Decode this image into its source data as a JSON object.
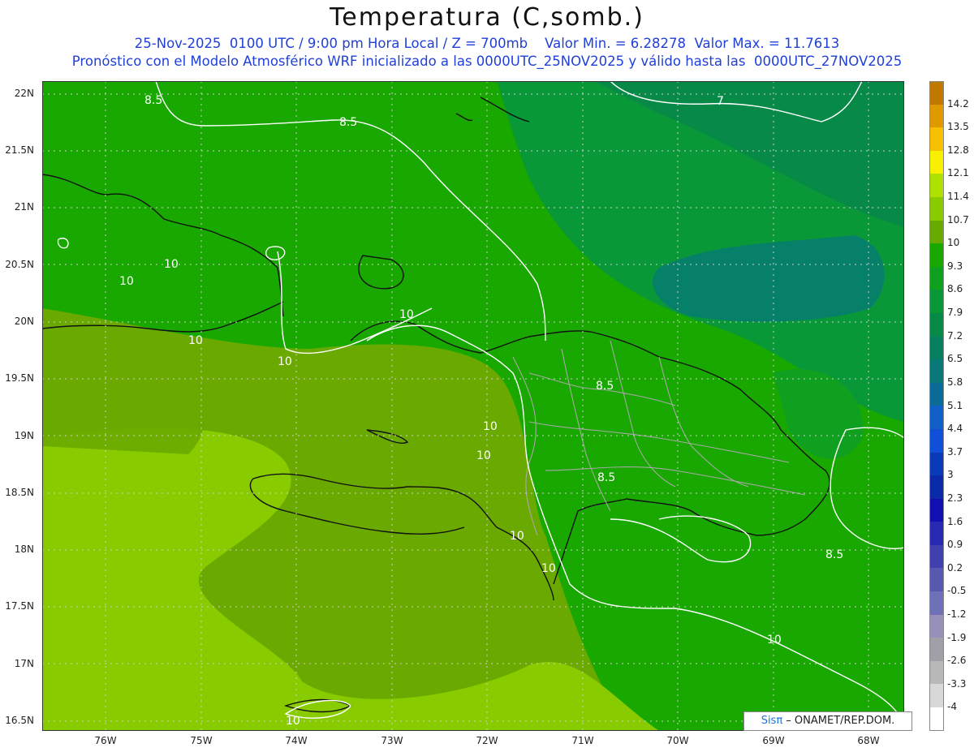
{
  "header": {
    "title": "Temperatura (C,somb.)",
    "line1": "25-Nov-2025  0100 UTC / 9:00 pm Hora Local / Z = 700mb    Valor Min. = 6.28278  Valor Max. = 11.7613",
    "line2": "Pronóstico con el Modelo Atmosférico WRF inicializado a las 0000UTC_25NOV2025 y válido hasta las  0000UTC_27NOV2025"
  },
  "axes": {
    "lat_labels": [
      "22N",
      "21.5N",
      "21N",
      "20.5N",
      "20N",
      "19.5N",
      "19N",
      "18.5N",
      "18N",
      "17.5N",
      "17N",
      "16.5N"
    ],
    "lon_labels": [
      "76W",
      "75W",
      "74W",
      "73W",
      "72W",
      "71W",
      "70W",
      "69W",
      "68W"
    ]
  },
  "legend": {
    "labels": [
      "14.2",
      "13.5",
      "12.8",
      "12.1",
      "11.4",
      "10.7",
      "10",
      "9.3",
      "8.6",
      "7.9",
      "7.2",
      "6.5",
      "5.8",
      "5.1",
      "4.4",
      "3.7",
      "3",
      "2.3",
      "1.6",
      "0.9",
      "0.2",
      "-0.5",
      "-1.2",
      "-1.9",
      "-2.6",
      "-3.3",
      "-4"
    ],
    "colors": [
      "#c07800",
      "#e09a00",
      "#f8c000",
      "#f8f000",
      "#b0e000",
      "#88cc00",
      "#6aaa00",
      "#18a800",
      "#10a020",
      "#089838",
      "#078a48",
      "#078060",
      "#087878",
      "#0a6a98",
      "#1060c8",
      "#1050d8",
      "#0a3ab8",
      "#0a2aa8",
      "#1010b0",
      "#2828b0",
      "#4040b0",
      "#5858b0",
      "#7070b8",
      "#9890b8",
      "#a0a0a8",
      "#b8b8b8",
      "#d8d8d8",
      "#ffffff"
    ]
  },
  "contour_labels": [
    "8.5",
    "8.5",
    "7",
    "10",
    "10",
    "10",
    "10",
    "8.5",
    "10",
    "10",
    "8.5",
    "10",
    "10",
    "8.5",
    "10",
    "10",
    "10"
  ],
  "credit": {
    "brand": "Sisπ",
    "text": " – ONAMET/REP.DOM."
  }
}
